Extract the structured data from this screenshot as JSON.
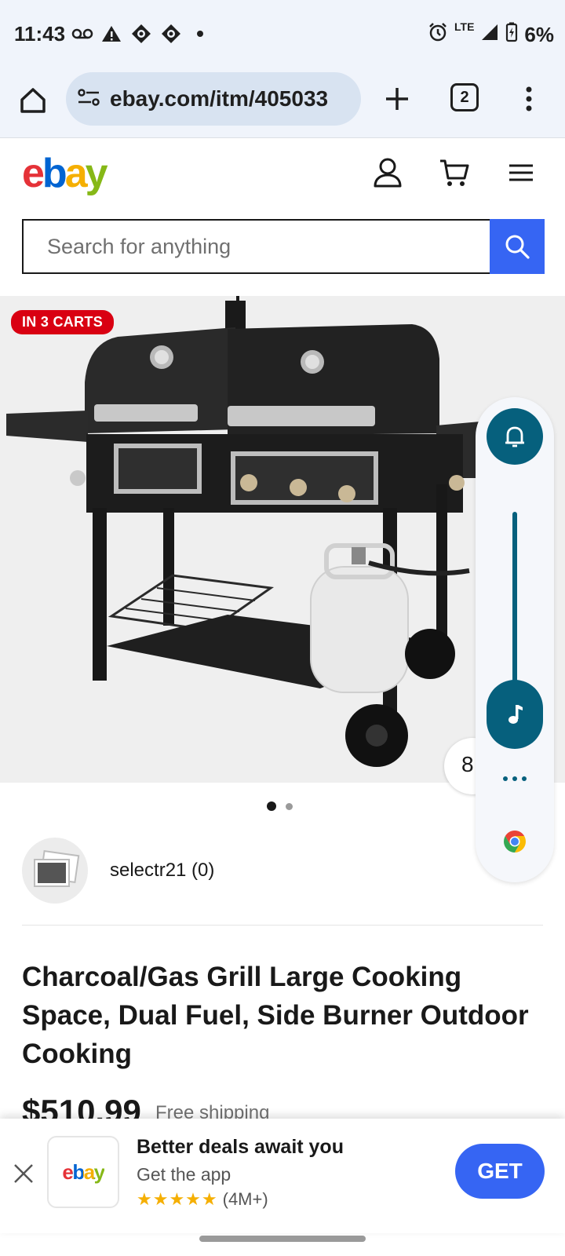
{
  "status_bar": {
    "time": "11:43",
    "network": "LTE",
    "battery": "6%"
  },
  "browser": {
    "url": "ebay.com/itm/405033",
    "tab_count": "2"
  },
  "header": {
    "logo": {
      "e": "e",
      "b": "b",
      "a": "a",
      "y": "y"
    }
  },
  "search": {
    "placeholder": "Search for anything"
  },
  "product": {
    "badge": "IN 3 CARTS",
    "seller": "selectr21 (0)",
    "title": "Charcoal/Gas Grill Large Cooking Space, Dual Fuel, Side Burner Outdoor Cooking",
    "price": "$510.99",
    "shipping": "Free shipping"
  },
  "side_panel": {
    "partial_label": "8"
  },
  "app_banner": {
    "logo_text": "ebay",
    "title": "Better deals await you",
    "subtitle": "Get the app",
    "stars": "★★★★★",
    "rating_count": "(4M+)",
    "cta": "GET"
  },
  "colors": {
    "ebay_red": "#e53238",
    "ebay_blue": "#0064d2",
    "ebay_yellow": "#f5af02",
    "ebay_green": "#86b817",
    "cta_blue": "#3665f3",
    "badge_red": "#d90012",
    "panel_teal": "#06607d"
  }
}
